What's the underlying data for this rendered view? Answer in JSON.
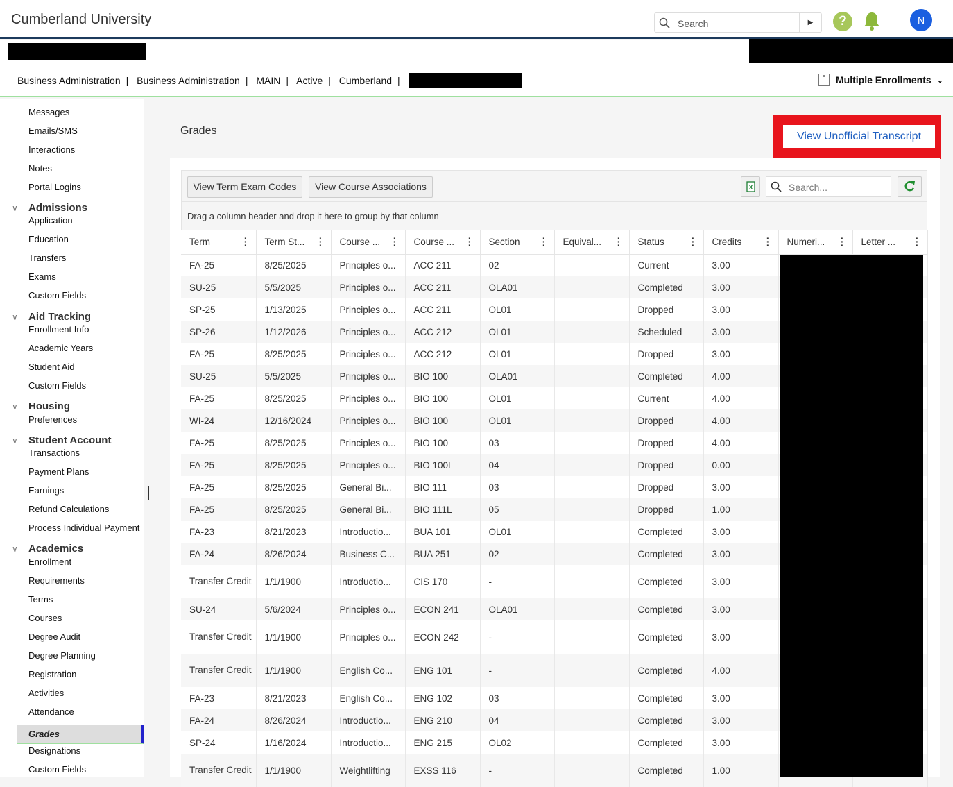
{
  "app": {
    "title": "Cumberland University"
  },
  "search": {
    "placeholder": "Search"
  },
  "user": {
    "initial": "N"
  },
  "enrollment": {
    "crumbs": [
      "Business Administration",
      "Business Administration",
      "MAIN",
      "Active",
      "Cumberland"
    ],
    "multiple_label": "Multiple Enrollments"
  },
  "sidebar": {
    "items": [
      {
        "label": "Messages",
        "type": "item"
      },
      {
        "label": "Emails/SMS",
        "type": "item"
      },
      {
        "label": "Interactions",
        "type": "item"
      },
      {
        "label": "Notes",
        "type": "item"
      },
      {
        "label": "Portal Logins",
        "type": "item"
      },
      {
        "label": "Admissions",
        "type": "group"
      },
      {
        "label": "Application",
        "type": "item"
      },
      {
        "label": "Education",
        "type": "item"
      },
      {
        "label": "Transfers",
        "type": "item"
      },
      {
        "label": "Exams",
        "type": "item"
      },
      {
        "label": "Custom Fields",
        "type": "item"
      },
      {
        "label": "Aid Tracking",
        "type": "group"
      },
      {
        "label": "Enrollment Info",
        "type": "item"
      },
      {
        "label": "Academic Years",
        "type": "item"
      },
      {
        "label": "Student Aid",
        "type": "item"
      },
      {
        "label": "Custom Fields",
        "type": "item"
      },
      {
        "label": "Housing",
        "type": "group"
      },
      {
        "label": "Preferences",
        "type": "item"
      },
      {
        "label": "Student Account",
        "type": "group"
      },
      {
        "label": "Transactions",
        "type": "item"
      },
      {
        "label": "Payment Plans",
        "type": "item"
      },
      {
        "label": "Earnings",
        "type": "item"
      },
      {
        "label": "Refund Calculations",
        "type": "item"
      },
      {
        "label": "Process Individual Payment",
        "type": "item"
      },
      {
        "label": "Academics",
        "type": "group"
      },
      {
        "label": "Enrollment",
        "type": "item"
      },
      {
        "label": "Requirements",
        "type": "item"
      },
      {
        "label": "Terms",
        "type": "item"
      },
      {
        "label": "Courses",
        "type": "item"
      },
      {
        "label": "Degree Audit",
        "type": "item"
      },
      {
        "label": "Degree Planning",
        "type": "item"
      },
      {
        "label": "Registration",
        "type": "item"
      },
      {
        "label": "Activities",
        "type": "item"
      },
      {
        "label": "Attendance",
        "type": "item"
      },
      {
        "label": "Grades",
        "type": "active"
      },
      {
        "label": "Designations",
        "type": "item"
      },
      {
        "label": "Custom Fields",
        "type": "item"
      }
    ]
  },
  "page": {
    "title": "Grades",
    "transcript_button": "View Unofficial Transcript",
    "term_exam_button": "View Term Exam Codes",
    "course_assoc_button": "View Course Associations",
    "grid_search_placeholder": "Search...",
    "group_hint": "Drag a column header and drop it here to group by that column"
  },
  "grid": {
    "columns": [
      "Term",
      "Term St...",
      "Course ...",
      "Course ...",
      "Section",
      "Equival...",
      "Status",
      "Credits",
      "Numeri...",
      "Letter ..."
    ],
    "rows": [
      [
        "FA-25",
        "8/25/2025",
        "Principles o...",
        "ACC 211",
        "02",
        "",
        "Current",
        "3.00"
      ],
      [
        "SU-25",
        "5/5/2025",
        "Principles o...",
        "ACC 211",
        "OLA01",
        "",
        "Completed",
        "3.00"
      ],
      [
        "SP-25",
        "1/13/2025",
        "Principles o...",
        "ACC 211",
        "OL01",
        "",
        "Dropped",
        "3.00"
      ],
      [
        "SP-26",
        "1/12/2026",
        "Principles o...",
        "ACC 212",
        "OL01",
        "",
        "Scheduled",
        "3.00"
      ],
      [
        "FA-25",
        "8/25/2025",
        "Principles o...",
        "ACC 212",
        "OL01",
        "",
        "Dropped",
        "3.00"
      ],
      [
        "SU-25",
        "5/5/2025",
        "Principles o...",
        "BIO 100",
        "OLA01",
        "",
        "Completed",
        "4.00"
      ],
      [
        "FA-25",
        "8/25/2025",
        "Principles o...",
        "BIO 100",
        "OL01",
        "",
        "Current",
        "4.00"
      ],
      [
        "WI-24",
        "12/16/2024",
        "Principles o...",
        "BIO 100",
        "OL01",
        "",
        "Dropped",
        "4.00"
      ],
      [
        "FA-25",
        "8/25/2025",
        "Principles o...",
        "BIO 100",
        "03",
        "",
        "Dropped",
        "4.00"
      ],
      [
        "FA-25",
        "8/25/2025",
        "Principles o...",
        "BIO 100L",
        "04",
        "",
        "Dropped",
        "0.00"
      ],
      [
        "FA-25",
        "8/25/2025",
        "General Bi...",
        "BIO 111",
        "03",
        "",
        "Dropped",
        "3.00"
      ],
      [
        "FA-25",
        "8/25/2025",
        "General Bi...",
        "BIO 111L",
        "05",
        "",
        "Dropped",
        "1.00"
      ],
      [
        "FA-23",
        "8/21/2023",
        "Introductio...",
        "BUA 101",
        "OL01",
        "",
        "Completed",
        "3.00"
      ],
      [
        "FA-24",
        "8/26/2024",
        "Business C...",
        "BUA 251",
        "02",
        "",
        "Completed",
        "3.00"
      ],
      [
        "Transfer Credit",
        "1/1/1900",
        "Introductio...",
        "CIS 170",
        "-",
        "",
        "Completed",
        "3.00"
      ],
      [
        "SU-24",
        "5/6/2024",
        "Principles o...",
        "ECON 241",
        "OLA01",
        "",
        "Completed",
        "3.00"
      ],
      [
        "Transfer Credit",
        "1/1/1900",
        "Principles o...",
        "ECON 242",
        "-",
        "",
        "Completed",
        "3.00"
      ],
      [
        "Transfer Credit",
        "1/1/1900",
        "English Co...",
        "ENG 101",
        "-",
        "",
        "Completed",
        "4.00"
      ],
      [
        "FA-23",
        "8/21/2023",
        "English Co...",
        "ENG 102",
        "03",
        "",
        "Completed",
        "3.00"
      ],
      [
        "FA-24",
        "8/26/2024",
        "Introductio...",
        "ENG 210",
        "04",
        "",
        "Completed",
        "3.00"
      ],
      [
        "SP-24",
        "1/16/2024",
        "Introductio...",
        "ENG 215",
        "OL02",
        "",
        "Completed",
        "3.00"
      ],
      [
        "Transfer Credit",
        "1/1/1900",
        "Weightlifting",
        "EXSS 116",
        "-",
        "",
        "Completed",
        "1.00"
      ]
    ]
  },
  "colors": {
    "accent": "#1f5fc1",
    "highlight": "#e8141c",
    "active_marker": "#2222cc",
    "green_line": "#9fe09f"
  }
}
